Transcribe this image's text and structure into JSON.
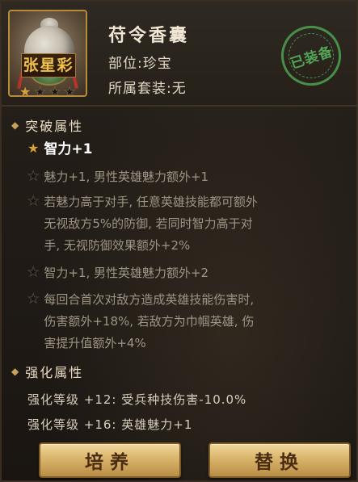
{
  "item": {
    "hero_name": "张星彩",
    "name": "苻令香囊",
    "slot_text": "部位:珍宝",
    "set_text": "所属套装:无",
    "equipped_text": "已装备",
    "stars": {
      "filled": 1,
      "total": 4
    }
  },
  "breakthrough": {
    "title": "突破属性",
    "lines": [
      {
        "active": true,
        "text": "智力+1"
      },
      {
        "active": false,
        "text": "魅力+1, 男性英雄魅力额外+1"
      },
      {
        "active": false,
        "text": "若魅力高于对手, 任意英雄技能都可额外\n无视敌方5%的防御, 若同时智力高于对\n手, 无视防御效果额外+2%"
      },
      {
        "active": false,
        "text": "智力+1, 男性英雄魅力额外+2"
      },
      {
        "active": false,
        "text": "每回合首次对敌方造成英雄技能伤害时,\n伤害额外+18%, 若敌方为巾帼英雄, 伤\n害提升值额外+4%"
      }
    ]
  },
  "strengthen": {
    "title": "强化属性",
    "lines": [
      "强化等级 +12: 受兵种技伤害-10.0%",
      "强化等级 +16: 英雄魅力+1"
    ]
  },
  "buttons": {
    "cultivate": "培养",
    "replace": "替换"
  },
  "colors": {
    "gold": "#d6a23d",
    "stamp_green": "#4b9b4e",
    "button_gold": "#d9b46a"
  }
}
